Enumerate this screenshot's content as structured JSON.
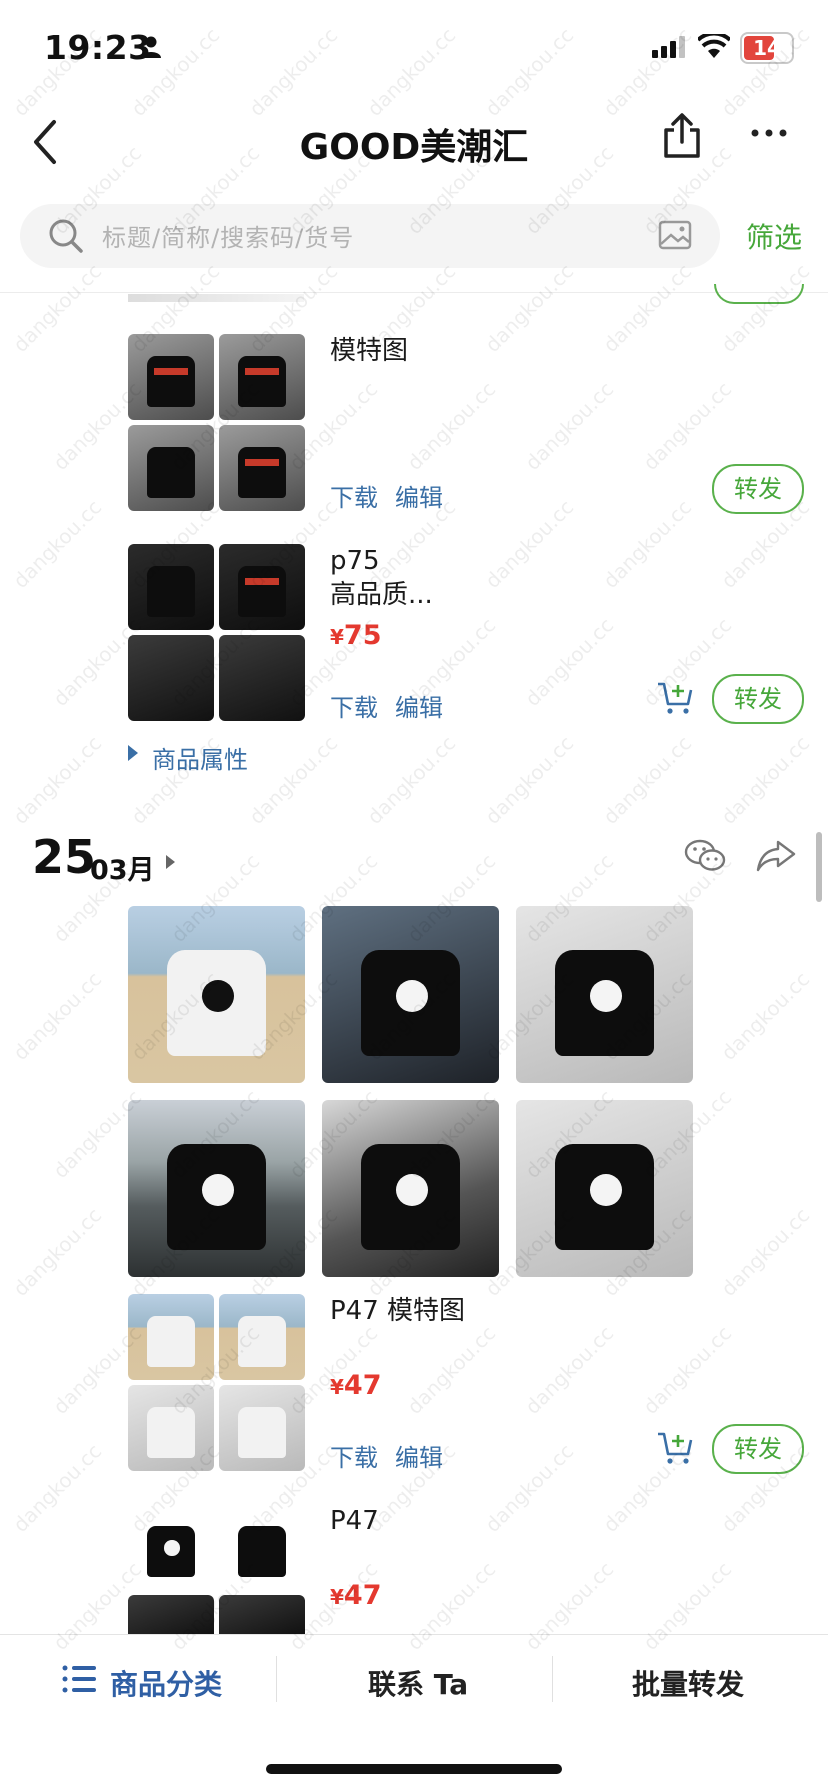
{
  "status_bar": {
    "time": "19:23",
    "battery": "14"
  },
  "nav": {
    "title": "GOOD美潮汇"
  },
  "search": {
    "placeholder": "标题/简称/搜索码/货号",
    "filter_label": "筛选"
  },
  "items": [
    {
      "title": "模特图",
      "price": "",
      "download": "下载",
      "edit": "编辑",
      "forward": "转发"
    },
    {
      "title_line1": "p75",
      "title_line2": "高品质...",
      "price": "75",
      "download": "下载",
      "edit": "编辑",
      "forward": "转发"
    }
  ],
  "attributes_label": "商品属性",
  "date_header": {
    "day": "25",
    "month": "03月"
  },
  "items2": [
    {
      "title": "P47 模特图",
      "price": "47",
      "download": "下载",
      "edit": "编辑",
      "forward": "转发"
    },
    {
      "title": "P47",
      "price": "47"
    }
  ],
  "currency_symbol": "¥",
  "bottom_bar": {
    "category": "商品分类",
    "contact": "联系 Ta",
    "batch_forward": "批量转发"
  },
  "watermark": "dangkou.cc",
  "colors": {
    "accent_green": "#46a73a",
    "price_red": "#e4392f",
    "link_blue": "#3a6fa6",
    "tab_blue": "#2f5fa4"
  },
  "icons": [
    "person-icon",
    "signal-icon",
    "wifi-icon",
    "battery-icon",
    "back-icon",
    "share-icon",
    "more-icon",
    "search-icon",
    "image-search-icon",
    "cart-add-icon",
    "wechat-icon",
    "forward-arrow-icon",
    "list-icon"
  ]
}
